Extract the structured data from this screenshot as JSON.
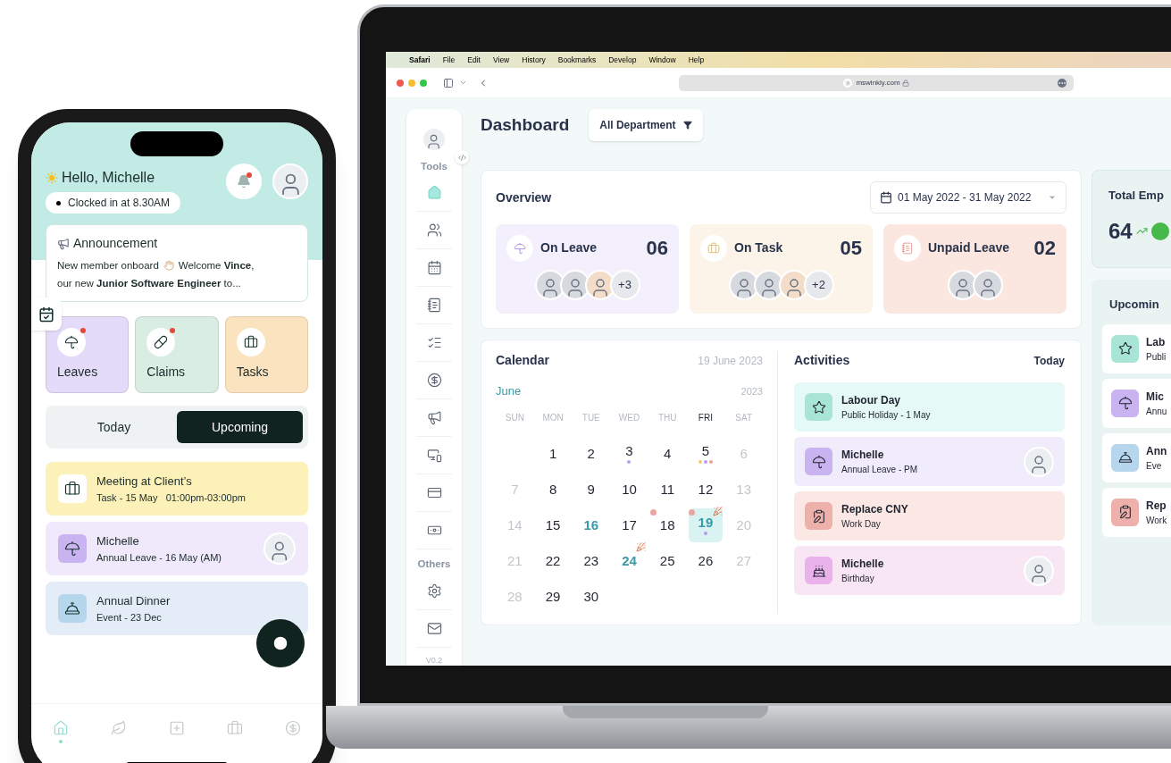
{
  "phone": {
    "greeting": "Hello, Michelle",
    "clock_status": "Clocked in at 8.30AM",
    "notification_unread": true,
    "announcement": {
      "title": "Announcement",
      "text_before": "New member onboard",
      "text_after": "Welcome **Vince**,",
      "text_continued": "our new **Junior Software Engineer** to..."
    },
    "tiles": [
      {
        "label": "Leaves",
        "kind": "leaves",
        "color": "#e4dbf8",
        "unread": true
      },
      {
        "label": "Claims",
        "kind": "claims",
        "color": "#d9ede3",
        "unread": true
      },
      {
        "label": "Tasks",
        "kind": "tasks",
        "color": "#fce3bf",
        "unread": false
      }
    ],
    "segments": [
      {
        "label": "Today",
        "selected": false
      },
      {
        "label": "Upcoming",
        "selected": true
      }
    ],
    "events": [
      {
        "title": "Meeting at Client’s",
        "subtitle": "Task - 15 May   01:00pm-03:00pm",
        "kind": "task",
        "color": "#fcf2b9",
        "avatar": false
      },
      {
        "title": "Michelle",
        "subtitle": "Annual Leave - 16 May (AM)",
        "kind": "leave",
        "color": "#f0e9fb",
        "avatar": true
      },
      {
        "title": "Annual Dinner",
        "subtitle": "Event - 23 Dec",
        "kind": "event",
        "color": "#e3ecf7",
        "avatar": false
      }
    ],
    "nav": [
      {
        "kind": "home",
        "selected": true
      },
      {
        "kind": "leaf",
        "selected": false
      },
      {
        "kind": "plus",
        "selected": false
      },
      {
        "kind": "briefcase",
        "selected": false
      },
      {
        "kind": "dollar",
        "selected": false
      }
    ]
  },
  "laptop": {
    "menu_bar": {
      "app": "Safari",
      "items": [
        "File",
        "Edit",
        "View",
        "History",
        "Bookmarks",
        "Develop",
        "Window",
        "Help"
      ]
    },
    "url": "mswinkly.com",
    "sidebar": {
      "sections": [
        {
          "label": "Tools",
          "items": [
            {
              "kind": "home",
              "selected": true
            },
            {
              "kind": "people",
              "selected": false
            },
            {
              "kind": "calendar",
              "selected": false
            },
            {
              "kind": "notes",
              "selected": false
            },
            {
              "kind": "checklist",
              "selected": false
            },
            {
              "kind": "dollar",
              "selected": false
            },
            {
              "kind": "megaphone",
              "selected": false
            },
            {
              "kind": "devices",
              "selected": false
            },
            {
              "kind": "card",
              "selected": false
            },
            {
              "kind": "money",
              "selected": false
            }
          ]
        },
        {
          "label": "Others",
          "items": [
            {
              "kind": "settings",
              "selected": false
            },
            {
              "kind": "mail",
              "selected": false
            }
          ]
        }
      ],
      "version": "V0.2"
    },
    "page_title": "Dashboard",
    "department_filter": "All Department",
    "overview": {
      "title": "Overview",
      "date_range": "01 May 2022 - 31 May 2022",
      "stats": [
        {
          "label": "On Leave",
          "count": "06",
          "kind": "leave",
          "color": "#f3effd",
          "avatars": [
            {
              "kind": "man"
            },
            {
              "kind": "man"
            },
            {
              "kind": "woman"
            }
          ],
          "extra": "+3"
        },
        {
          "label": "On Task",
          "count": "05",
          "kind": "task",
          "color": "#fdf4e9",
          "avatars": [
            {
              "kind": "man"
            },
            {
              "kind": "man"
            },
            {
              "kind": "woman"
            }
          ],
          "extra": "+2"
        },
        {
          "label": "Unpaid Leave",
          "count": "02",
          "kind": "unpaid",
          "color": "#fbe7e0",
          "avatars": [
            {
              "kind": "man"
            },
            {
              "kind": "man"
            }
          ]
        }
      ]
    },
    "calendar": {
      "title": "Calendar",
      "date": "19 June 2023",
      "month": "June",
      "year": "2023",
      "weekdays": [
        {
          "label": "SUN",
          "selected": false
        },
        {
          "label": "MON",
          "selected": false
        },
        {
          "label": "TUE",
          "selected": false
        },
        {
          "label": "WED",
          "selected": false
        },
        {
          "label": "THU",
          "selected": false
        },
        {
          "label": "FRI",
          "selected": true
        },
        {
          "label": "SAT",
          "selected": false
        }
      ],
      "weeks": [
        [
          {
            "kind": "blank"
          },
          {
            "day": "1",
            "kind": "weekday"
          },
          {
            "day": "2",
            "kind": "weekday"
          },
          {
            "day": "3",
            "kind": "weekday",
            "dots": [
              {
                "color": "#b89cf0"
              }
            ]
          },
          {
            "day": "4",
            "kind": "weekday"
          },
          {
            "day": "5",
            "kind": "weekday",
            "dots": [
              {
                "color": "#f5c96b"
              },
              {
                "color": "#b89cf0"
              },
              {
                "color": "#f0a0a0"
              }
            ]
          },
          {
            "day": "6",
            "kind": "weekend"
          }
        ],
        [
          {
            "day": "7",
            "kind": "weekend"
          },
          {
            "day": "8",
            "kind": "weekday"
          },
          {
            "day": "9",
            "kind": "weekday"
          },
          {
            "day": "10",
            "kind": "weekday"
          },
          {
            "day": "11",
            "kind": "weekday"
          },
          {
            "day": "12",
            "kind": "weekday"
          },
          {
            "day": "13",
            "kind": "weekend"
          }
        ],
        [
          {
            "day": "14",
            "kind": "weekend"
          },
          {
            "day": "15",
            "kind": "weekday"
          },
          {
            "day": "16",
            "kind": "highlight"
          },
          {
            "day": "17",
            "kind": "weekday"
          },
          {
            "day": "18",
            "kind": "weekday",
            "markers": [
              {
                "kind": "dot"
              }
            ]
          },
          {
            "day": "19",
            "kind": "selected",
            "dots": [
              {
                "color": "#b89cf0"
              }
            ],
            "markers": [
              {
                "kind": "dot"
              },
              {
                "kind": "party"
              }
            ]
          },
          {
            "day": "20",
            "kind": "weekend"
          }
        ],
        [
          {
            "day": "21",
            "kind": "weekend"
          },
          {
            "day": "22",
            "kind": "weekday"
          },
          {
            "day": "23",
            "kind": "weekday"
          },
          {
            "day": "24",
            "kind": "highlight",
            "markers": [
              {
                "kind": "party"
              }
            ]
          },
          {
            "day": "25",
            "kind": "weekday"
          },
          {
            "day": "26",
            "kind": "weekday"
          },
          {
            "day": "27",
            "kind": "weekend"
          }
        ],
        [
          {
            "day": "28",
            "kind": "weekend"
          },
          {
            "day": "29",
            "kind": "weekday"
          },
          {
            "day": "30",
            "kind": "weekday"
          }
        ]
      ]
    },
    "activities": {
      "title": "Activities",
      "filter": "Today",
      "items": [
        {
          "title": "Labour Day",
          "subtitle": "Public Holiday - 1 May",
          "kind": "holiday",
          "color": "#e5f9f6",
          "avatar": false
        },
        {
          "title": "Michelle",
          "subtitle": "Annual Leave - PM",
          "kind": "leave",
          "color": "#f1ecfb",
          "avatar": true
        },
        {
          "title": "Replace CNY",
          "subtitle": "Work Day",
          "kind": "work",
          "color": "#fbe8e5",
          "avatar": false
        },
        {
          "title": "Michelle",
          "subtitle": "Birthday",
          "kind": "birthday",
          "color": "#f9e6f5",
          "avatar": true
        }
      ]
    },
    "total_employees": {
      "label": "Total Emp",
      "value": "64"
    },
    "upcoming": {
      "title": "Upcomin",
      "items": [
        {
          "title": "Lab",
          "subtitle": "Publi",
          "kind": "holiday"
        },
        {
          "title": "Mic",
          "subtitle": "Annu",
          "kind": "leave"
        },
        {
          "title": "Ann",
          "subtitle": "Eve",
          "kind": "event"
        },
        {
          "title": "Rep",
          "subtitle": "Work",
          "kind": "work"
        }
      ]
    }
  }
}
